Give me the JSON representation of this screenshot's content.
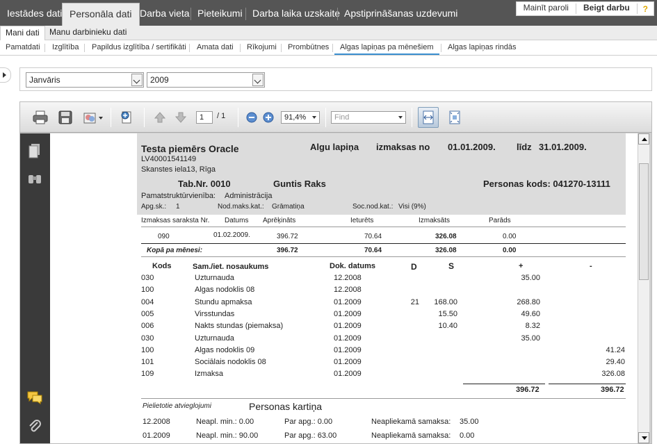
{
  "topnav": {
    "tabs": [
      "Iestādes dati",
      "Personāla dati",
      "Darba vieta",
      "Pieteikumi",
      "Darba laika uzskaite",
      "Apstiprināšanas uzdevumi"
    ],
    "right": {
      "change_password": "Mainīt paroli",
      "logout": "Beigt darbu",
      "help": "?"
    }
  },
  "subnav": {
    "items": [
      "Mani dati",
      "Manu darbinieku dati"
    ]
  },
  "tabs3": {
    "items": [
      "Pamatdati",
      "Izglītība",
      "Papildus izglītība / sertifikāti",
      "Amata dati",
      "Rīkojumi",
      "Prombūtnes",
      "Algas lapiņas pa mēnešiem",
      "Algas lapiņas rindās"
    ]
  },
  "filters": {
    "month": "Janvāris",
    "year": "2009"
  },
  "pdf_toolbar": {
    "page_current": "1",
    "page_total": "/ 1",
    "zoom": "91,4%",
    "find_placeholder": "Find"
  },
  "payslip": {
    "company": "Testa piemērs Oracle",
    "reg_no": "LV40001541149",
    "address": "Skanstes iela13, Rīga",
    "title": "Algu lapiņa",
    "period_label": "izmaksas no",
    "period_from": "01.01.2009.",
    "period_to_label": "līdz",
    "period_to": "31.01.2009.",
    "tab_nr": "Tab.Nr. 0010",
    "employee_name": "Guntis Raks",
    "personal_code": "Personas kods: 041270-13111",
    "unit_label": "Pamatstruktūrvienība:",
    "unit_value": "Administrācija",
    "apg_label": "Apg.sk.:",
    "apg_value": "1",
    "nod_label": "Nod.maks.kat.:",
    "nod_value": "Grāmatiņa",
    "soc_label": "Soc.nod.kat.:",
    "soc_value": "Visi (9%)",
    "pay_header": [
      "Izmaksas saraksta Nr.",
      "Datums",
      "Aprēķināts",
      "Ieturēts",
      "Izmaksāts",
      "Parāds"
    ],
    "pay_row": [
      "090",
      "01.02.2009.",
      "396.72",
      "70.64",
      "326.08",
      "0.00"
    ],
    "total_label": "Kopā pa mēnesi:",
    "total_row": [
      "396.72",
      "70.64",
      "326.08",
      "0.00"
    ],
    "items_header": [
      "Kods",
      "Sam./iet. nosaukums",
      "Dok. datums",
      "D",
      "S",
      "+",
      "-"
    ],
    "items": [
      {
        "code": "030",
        "name": "Uzturnauda",
        "date": "12.2008",
        "d": "",
        "s": "",
        "plus": "35.00",
        "minus": ""
      },
      {
        "code": "100",
        "name": "Algas nodoklis 08",
        "date": "12.2008",
        "d": "",
        "s": "",
        "plus": "",
        "minus": ""
      },
      {
        "code": "004",
        "name": "Stundu apmaksa",
        "date": "01.2009",
        "d": "21",
        "s": "168.00",
        "plus": "268.80",
        "minus": ""
      },
      {
        "code": "005",
        "name": "Virsstundas",
        "date": "01.2009",
        "d": "",
        "s": "15.50",
        "plus": "49.60",
        "minus": ""
      },
      {
        "code": "006",
        "name": "Nakts stundas (piemaksa)",
        "date": "01.2009",
        "d": "",
        "s": "10.40",
        "plus": "8.32",
        "minus": ""
      },
      {
        "code": "030",
        "name": "Uzturnauda",
        "date": "01.2009",
        "d": "",
        "s": "",
        "plus": "35.00",
        "minus": ""
      },
      {
        "code": "100",
        "name": "Algas nodoklis 09",
        "date": "01.2009",
        "d": "",
        "s": "",
        "plus": "",
        "minus": "41.24"
      },
      {
        "code": "101",
        "name": "Sociālais nodoklis 08",
        "date": "01.2009",
        "d": "",
        "s": "",
        "plus": "",
        "minus": "29.40"
      },
      {
        "code": "109",
        "name": "Izmaksa",
        "date": "01.2009",
        "d": "",
        "s": "",
        "plus": "",
        "minus": "326.08"
      }
    ],
    "sum_plus": "396.72",
    "sum_minus": "396.72",
    "relief_label": "Pielietotie atvieglojumi",
    "card_title": "Personas kartiņa",
    "relief_rows": [
      {
        "month": "12.2008",
        "neapl": "Neapl. min.: 0.00",
        "par_apg": "Par apg.: 0.00",
        "neapl_sum_label": "Neapliekamā samaksa:",
        "neapl_sum": "35.00"
      },
      {
        "month": "01.2009",
        "neapl": "Neapl. min.: 90.00",
        "par_apg": "Par apg.: 63.00",
        "neapl_sum_label": "Neapliekamā samaksa:",
        "neapl_sum": "0.00"
      }
    ]
  }
}
